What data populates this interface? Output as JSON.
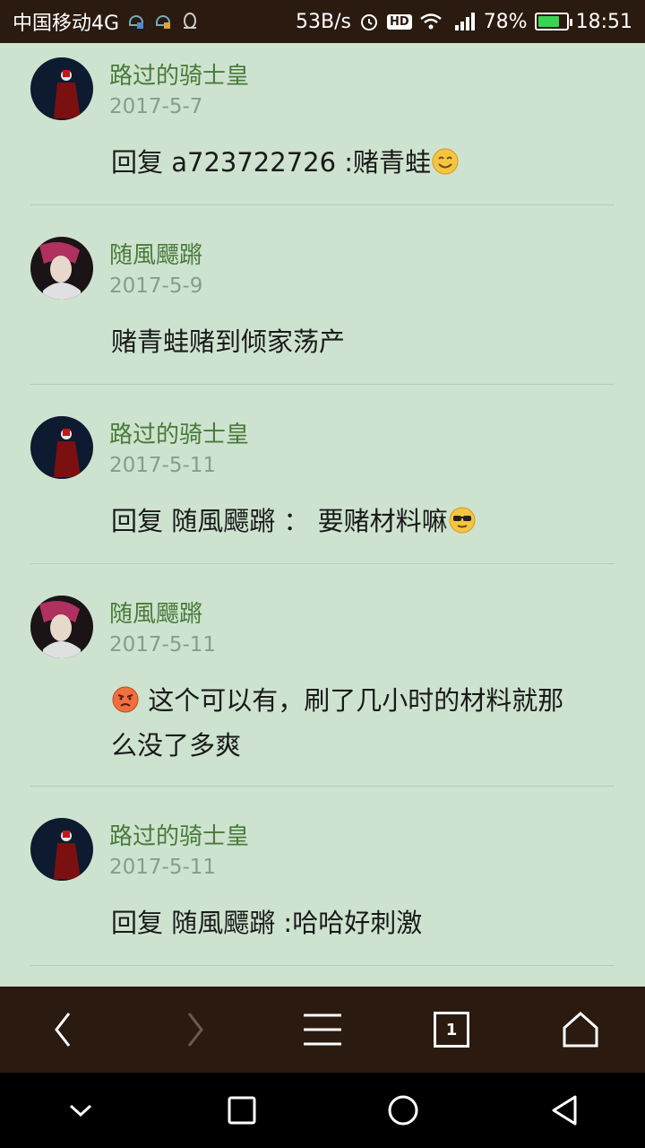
{
  "status_bar": {
    "carrier": "中国移动4G",
    "speed": "53B/s",
    "battery_pct": "78%",
    "time": "18:51",
    "hd_label": "HD",
    "network_label": "4G"
  },
  "comments": [
    {
      "username": "路过的骑士皇",
      "date": "2017-5-7",
      "text": "回复 a723722726 :赌青蛙",
      "emoji_after": "smile-emoji",
      "avatar": "knight-avatar"
    },
    {
      "username": "随風飃蹡",
      "date": "2017-5-9",
      "text": "赌青蛙赌到倾家荡产",
      "avatar": "redhair-avatar"
    },
    {
      "username": "路过的骑士皇",
      "date": "2017-5-11",
      "text": "回复 随風飃蹡 ： 要赌材料嘛",
      "emoji_after": "sunglasses-emoji",
      "avatar": "knight-avatar"
    },
    {
      "username": "随風飃蹡",
      "date": "2017-5-11",
      "text_line1": "这个可以有，刷了几小时的材料就那",
      "text_line2": "么没了多爽",
      "emoji_before": "angry-emoji",
      "avatar": "redhair-avatar"
    },
    {
      "username": "路过的骑士皇",
      "date": "2017-5-11",
      "text": "回复 随風飃蹡 :哈哈好刺激",
      "avatar": "knight-avatar"
    }
  ],
  "toolbar": {
    "tab_count": "1",
    "icons": [
      "back-icon",
      "forward-icon",
      "menu-icon",
      "tabs-icon",
      "home-icon"
    ]
  },
  "navbar": {
    "icons": [
      "collapse-icon",
      "recents-icon",
      "home-circle-icon",
      "back-triangle-icon"
    ]
  },
  "colors": {
    "background": "#cde3cf",
    "username": "#4a7a3a",
    "date": "#8a9a8c",
    "bars": "#2a1a10"
  }
}
